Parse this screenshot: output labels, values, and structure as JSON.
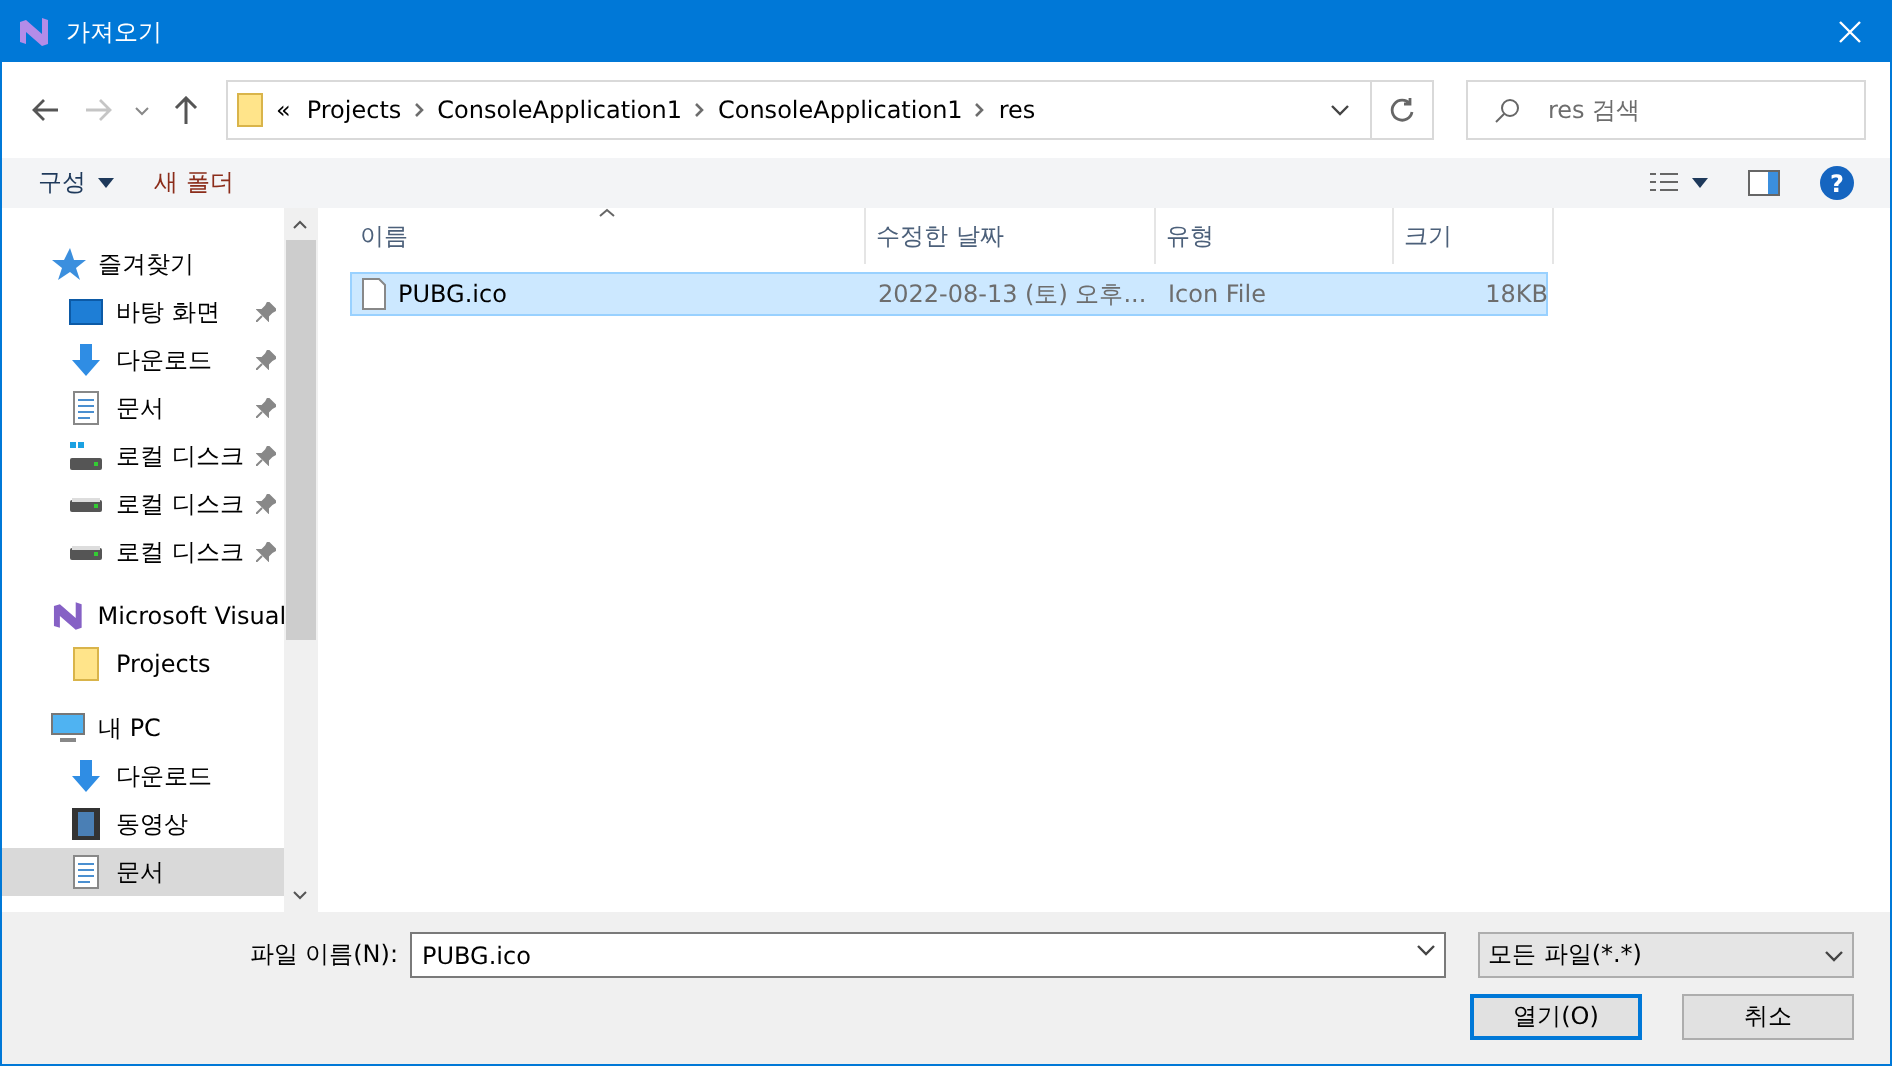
{
  "window": {
    "title": "가져오기"
  },
  "address": {
    "overflow": "«",
    "crumbs": [
      "Projects",
      "ConsoleApplication1",
      "ConsoleApplication1",
      "res"
    ]
  },
  "search": {
    "placeholder": "res 검색"
  },
  "toolbar": {
    "organize": "구성",
    "new_folder": "새 폴더",
    "help": "?"
  },
  "sidebar": {
    "items": [
      {
        "label": "즐겨찾기",
        "kind": "star",
        "indent": false,
        "pinned": false,
        "selected": false
      },
      {
        "label": "바탕 화면",
        "kind": "desktop",
        "indent": true,
        "pinned": true,
        "selected": false
      },
      {
        "label": "다운로드",
        "kind": "download",
        "indent": true,
        "pinned": true,
        "selected": false
      },
      {
        "label": "문서",
        "kind": "document",
        "indent": true,
        "pinned": true,
        "selected": false
      },
      {
        "label": "로컬 디스크",
        "kind": "windisk",
        "indent": true,
        "pinned": true,
        "selected": false
      },
      {
        "label": "로컬 디스크",
        "kind": "disk",
        "indent": true,
        "pinned": true,
        "selected": false
      },
      {
        "label": "로컬 디스크",
        "kind": "disk",
        "indent": true,
        "pinned": true,
        "selected": false
      },
      {
        "label": "Microsoft Visual",
        "kind": "vs",
        "indent": false,
        "pinned": false,
        "selected": false
      },
      {
        "label": "Projects",
        "kind": "folder",
        "indent": true,
        "pinned": false,
        "selected": false
      },
      {
        "label": "내 PC",
        "kind": "pc",
        "indent": false,
        "pinned": false,
        "selected": false
      },
      {
        "label": "다운로드",
        "kind": "download",
        "indent": true,
        "pinned": false,
        "selected": false
      },
      {
        "label": "동영상",
        "kind": "video",
        "indent": true,
        "pinned": false,
        "selected": false
      },
      {
        "label": "문서",
        "kind": "document",
        "indent": true,
        "pinned": false,
        "selected": true
      }
    ]
  },
  "table": {
    "columns": [
      "이름",
      "수정한 날짜",
      "유형",
      "크기"
    ],
    "rows": [
      {
        "name": "PUBG.ico",
        "modified": "2022-08-13 (토) 오후...",
        "type": "Icon File",
        "size": "18KB",
        "selected": true
      }
    ]
  },
  "footer": {
    "filename_label": "파일 이름(N):",
    "filename": "PUBG.ico",
    "filter": "모든 파일(*.*)",
    "open": "열기(O)",
    "cancel": "취소"
  }
}
